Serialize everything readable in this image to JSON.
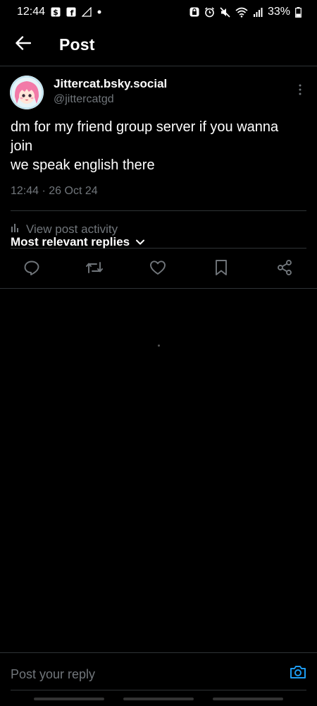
{
  "status_bar": {
    "time": "12:44",
    "battery": "33%"
  },
  "header": {
    "title": "Post",
    "back_icon": "arrow-left-icon"
  },
  "post": {
    "display_name": "Jittercat.bsky.social",
    "handle": "@jittercatgd",
    "text_lines": [
      "dm for my friend group server if you wanna",
      "join",
      "we speak english there"
    ],
    "timestamp": "12:44 · 26 Oct 24",
    "activity_label": "View post activity"
  },
  "actions": {
    "reply_icon": "reply-icon",
    "repost_icon": "repost-icon",
    "like_icon": "like-icon",
    "bookmark_icon": "bookmark-icon",
    "share_icon": "share-icon"
  },
  "replies": {
    "sort_label": "Most relevant replies"
  },
  "composer": {
    "placeholder": "Post your reply"
  },
  "colors": {
    "background": "#000000",
    "text": "#ffffff",
    "secondary_text": "#71767b",
    "divider": "#2f3336",
    "accent": "#1d9bf0"
  }
}
